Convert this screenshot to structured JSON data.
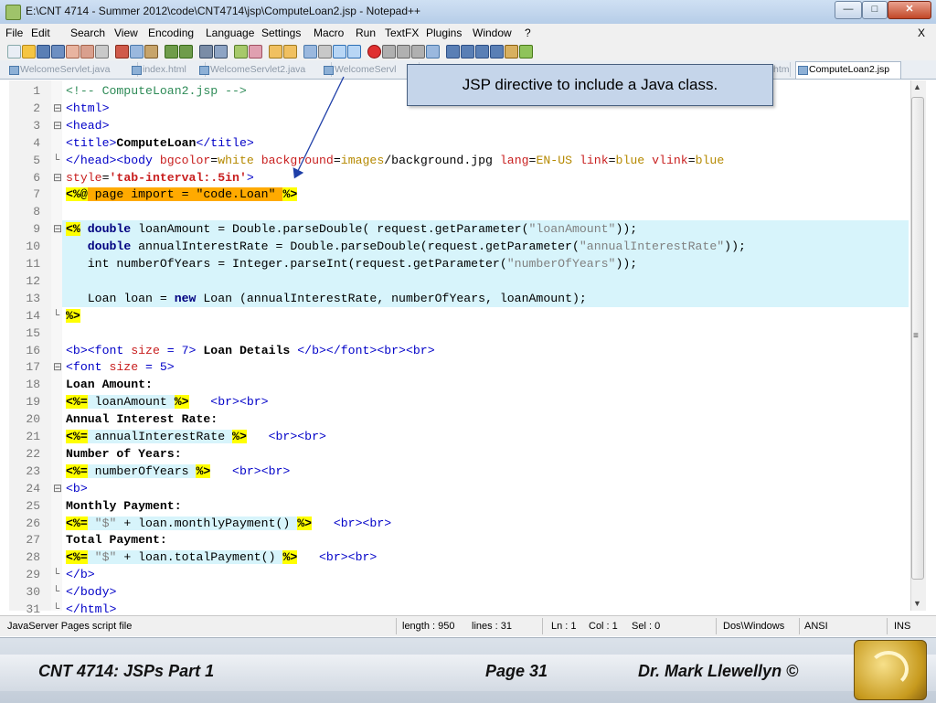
{
  "window": {
    "title": "E:\\CNT 4714 - Summer 2012\\code\\CNT4714\\jsp\\ComputeLoan2.jsp - Notepad++",
    "minimize": "—",
    "maximize": "□",
    "close": "✕"
  },
  "menu": [
    "File",
    "Edit",
    "Search",
    "View",
    "Encoding",
    "Language",
    "Settings",
    "Macro",
    "Run",
    "TextFX",
    "Plugins",
    "Window",
    "?"
  ],
  "menu_close": "X",
  "tabs": [
    "WelcomeServlet.java",
    "index.html",
    "WelcomeServlet2.java",
    "WelcomeServl",
    "html",
    "ComputeLoan2.jsp"
  ],
  "callout": "JSP directive to include a Java class.",
  "lines": [
    {
      "n": "1",
      "fold": ""
    },
    {
      "n": "2",
      "fold": "⊟"
    },
    {
      "n": "3",
      "fold": "⊟"
    },
    {
      "n": "4",
      "fold": ""
    },
    {
      "n": "5",
      "fold": "└"
    },
    {
      "n": "6",
      "fold": "⊟"
    },
    {
      "n": "7",
      "fold": ""
    },
    {
      "n": "8",
      "fold": ""
    },
    {
      "n": "9",
      "fold": "⊟"
    },
    {
      "n": "10",
      "fold": ""
    },
    {
      "n": "11",
      "fold": ""
    },
    {
      "n": "12",
      "fold": ""
    },
    {
      "n": "13",
      "fold": ""
    },
    {
      "n": "14",
      "fold": "└"
    },
    {
      "n": "15",
      "fold": ""
    },
    {
      "n": "16",
      "fold": ""
    },
    {
      "n": "17",
      "fold": "⊟"
    },
    {
      "n": "18",
      "fold": ""
    },
    {
      "n": "19",
      "fold": ""
    },
    {
      "n": "20",
      "fold": ""
    },
    {
      "n": "21",
      "fold": ""
    },
    {
      "n": "22",
      "fold": ""
    },
    {
      "n": "23",
      "fold": ""
    },
    {
      "n": "24",
      "fold": "⊟"
    },
    {
      "n": "25",
      "fold": ""
    },
    {
      "n": "26",
      "fold": ""
    },
    {
      "n": "27",
      "fold": ""
    },
    {
      "n": "28",
      "fold": ""
    },
    {
      "n": "29",
      "fold": "└"
    },
    {
      "n": "30",
      "fold": "└"
    },
    {
      "n": "31",
      "fold": "└"
    }
  ],
  "code": {
    "l1": "<!-- ComputeLoan2.jsp -->",
    "l2": "<html>",
    "l3": "<head>",
    "l4": {
      "a": "<title>",
      "b": "ComputeLoan",
      "c": "</title>"
    },
    "l5": {
      "a": "</head><body ",
      "b": "bgcolor",
      "c": "=",
      "d": "white",
      "e": " background",
      "f": "=",
      "g": "images",
      "h": "/background.jpg ",
      "i": "lang",
      "j": "=",
      "k": "EN-US",
      "l": " link",
      "m": "=",
      "n": "blue",
      "o": " vlink",
      "p": "=",
      "q": "blue"
    },
    "l6": {
      "a": "style",
      "b": "=",
      "c": "'tab-interval:.5in'",
      "d": ">"
    },
    "l7": {
      "a": "<%@",
      "b": " page import = \"code.Loan\" ",
      "c": "%>"
    },
    "l9": {
      "a": "<%",
      "b": " double",
      "c": " loanAmount = Double.parseDouble( request.getParameter(",
      "d": "\"loanAmount\"",
      "e": "));"
    },
    "l10": {
      "a": "double",
      "b": " annualInterestRate = Double.parseDouble(request.getParameter(",
      "c": "\"annualInterestRate\"",
      "d": "));"
    },
    "l11": {
      "a": "int numberOfYears = Integer.parseInt(request.getParameter(",
      "b": "\"numberOfYears\"",
      "c": "));"
    },
    "l13": {
      "a": "Loan loan = ",
      "b": "new",
      "c": " Loan (annualInterestRate, numberOfYears, loanAmount);"
    },
    "l14": "%>",
    "l16": {
      "a": "<b><font ",
      "b": "size",
      "c": " = 7>",
      "d": " Loan Details ",
      "e": "</b></font><br><br>"
    },
    "l17": {
      "a": "<font ",
      "b": "size",
      "c": " = 5>"
    },
    "l18": "Loan Amount:",
    "l19": {
      "a": "<%=",
      "b": " loanAmount ",
      "c": "%>",
      "d": "   <br><br>"
    },
    "l20": "Annual Interest Rate:",
    "l21": {
      "a": "<%=",
      "b": " annualInterestRate ",
      "c": "%>",
      "d": "   <br><br>"
    },
    "l22": "Number of Years:",
    "l23": {
      "a": "<%=",
      "b": " numberOfYears ",
      "c": "%>",
      "d": "   <br><br>"
    },
    "l24": "<b>",
    "l25": "Monthly Payment:",
    "l26": {
      "a": "<%=",
      "b": " \"$\"",
      "c": " + loan.monthlyPayment() ",
      "d": "%>",
      "e": "   <br><br>"
    },
    "l27": "Total Payment:",
    "l28": {
      "a": "<%=",
      "b": " \"$\"",
      "c": " + loan.totalPayment() ",
      "d": "%>",
      "e": "   <br><br>"
    },
    "l29": "</b>",
    "l30": "</body>",
    "l31": "</html>"
  },
  "status": {
    "filetype": "JavaServer Pages script file",
    "length": "length : 950",
    "lines": "lines : 31",
    "ln": "Ln : 1",
    "col": "Col : 1",
    "sel": "Sel : 0",
    "eol": "Dos\\Windows",
    "encoding": "ANSI",
    "mode": "INS"
  },
  "footer": {
    "course": "CNT 4714:  JSPs Part 1",
    "page": "Page 31",
    "author": "Dr. Mark Llewellyn ©"
  },
  "colors": {
    "callout_bg": "#c5d5ea",
    "delimiter": "#ffff00",
    "highlight": "#d7f4fb"
  }
}
